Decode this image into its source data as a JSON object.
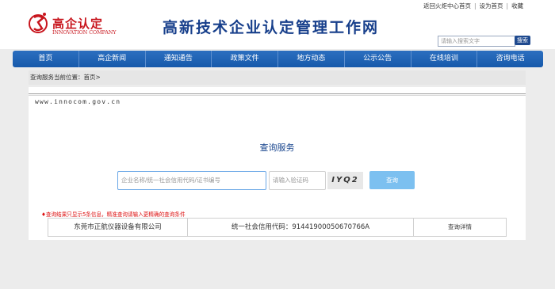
{
  "header": {
    "logo_cn": "高企认定",
    "logo_en": "INNOVATION COMPANY",
    "site_title": "高新技术企业认定管理工作网",
    "top_links": [
      "返回火炬中心首页",
      "设为首页",
      "收藏"
    ],
    "search_placeholder": "请输入搜索文字",
    "search_button": "搜索"
  },
  "nav": {
    "items": [
      "首页",
      "高企新闻",
      "通知通告",
      "政策文件",
      "地方动态",
      "公示公告",
      "在线培训",
      "咨询电话"
    ]
  },
  "breadcrumb": {
    "prefix": "查询服务当前位置：",
    "current": "首页>"
  },
  "panel": {
    "url_text": "www.innocom.gov.cn",
    "title": "查询服务",
    "query_placeholder": "企业名称/统一社会信用代码/证书编号",
    "verify_placeholder": "请输入验证码",
    "captcha_text": "IYQ2",
    "query_button": "查询",
    "notice": "♦查询结果只显示5条信息，精准查询请输入更精确的查询条件",
    "results": [
      {
        "company": "东莞市正航仪器设备有限公司",
        "code": "统一社会信用代码：91441900050670766A",
        "action": "查询详情"
      }
    ]
  },
  "colors": {
    "brand_red": "#c8151d",
    "nav_blue": "#1659ab",
    "title_blue": "#173f8b",
    "button_light_blue": "#7cc0f0",
    "notice_red": "#dd1111"
  }
}
